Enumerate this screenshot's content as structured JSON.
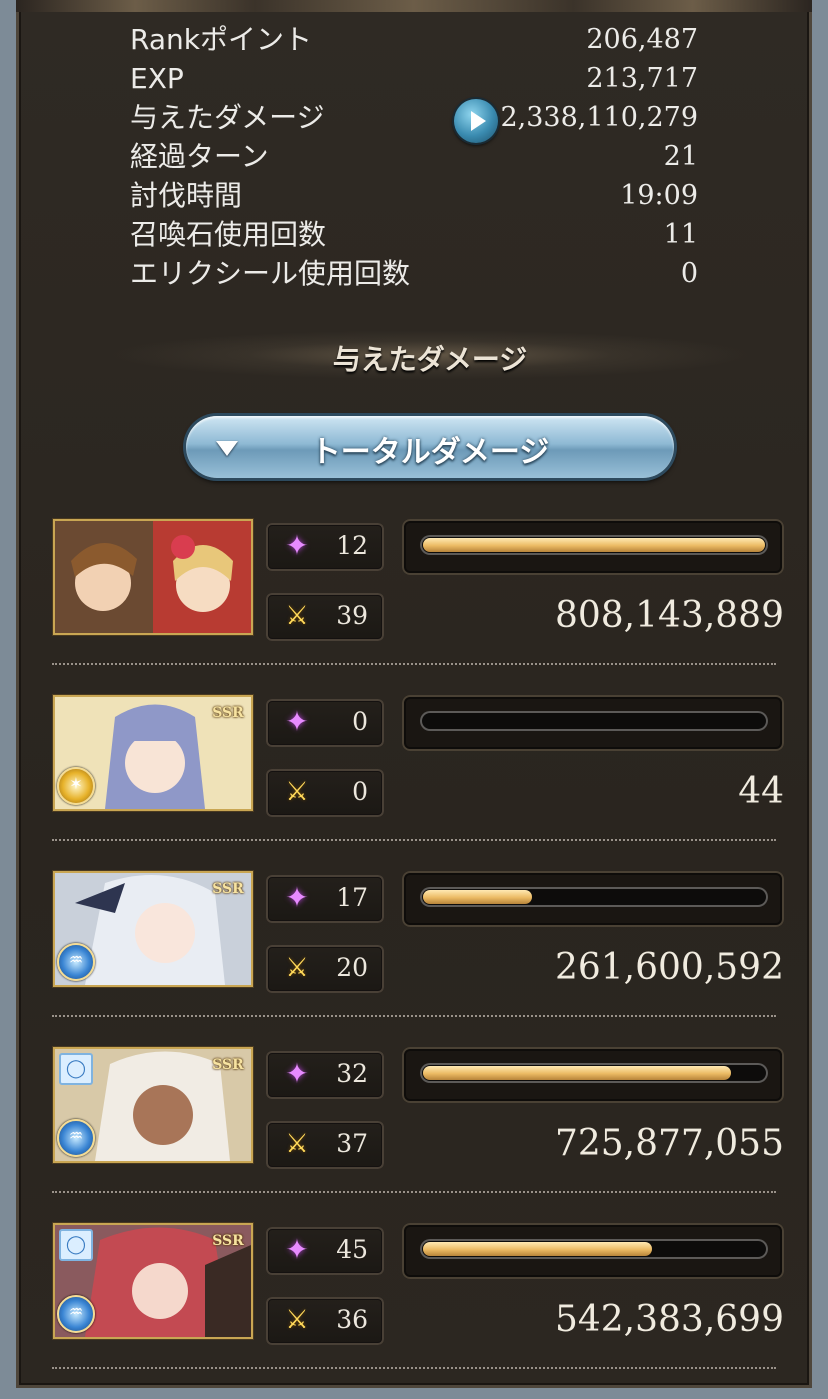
{
  "stats": [
    {
      "label": "Rankポイント",
      "value": "206,487"
    },
    {
      "label": "EXP",
      "value": "213,717"
    },
    {
      "label": "与えたダメージ",
      "value": "2,338,110,279"
    },
    {
      "label": "経過ターン",
      "value": "21"
    },
    {
      "label": "討伐時間",
      "value": "19:09"
    },
    {
      "label": "召喚石使用回数",
      "value": "11"
    },
    {
      "label": "エリクシール使用回数",
      "value": "0"
    }
  ],
  "section": {
    "title": "与えたダメージ"
  },
  "dropdown": {
    "label": "トータルダメージ"
  },
  "characters": [
    {
      "ssr": "",
      "element": "",
      "ring": false,
      "skill_count": "12",
      "attack_count": "39",
      "bar_fraction": 1.0,
      "damage": "808,143,889"
    },
    {
      "ssr": "SSR",
      "element": "light",
      "ring": false,
      "skill_count": "0",
      "attack_count": "0",
      "bar_fraction": 0.0,
      "damage": "44"
    },
    {
      "ssr": "SSR",
      "element": "water",
      "ring": false,
      "skill_count": "17",
      "attack_count": "20",
      "bar_fraction": 0.32,
      "damage": "261,600,592"
    },
    {
      "ssr": "SSR",
      "element": "water",
      "ring": true,
      "skill_count": "32",
      "attack_count": "37",
      "bar_fraction": 0.9,
      "damage": "725,877,055"
    },
    {
      "ssr": "SSR",
      "element": "water",
      "ring": true,
      "skill_count": "45",
      "attack_count": "36",
      "bar_fraction": 0.67,
      "damage": "542,383,699"
    }
  ],
  "icons": {
    "play": "play-icon",
    "dropdown_arrow": "triangle-down-icon",
    "skill": "sparkle-icon",
    "attack": "crossed-swords-icon",
    "light": "light-element-icon",
    "water": "water-element-icon",
    "ring": "ring-icon"
  }
}
